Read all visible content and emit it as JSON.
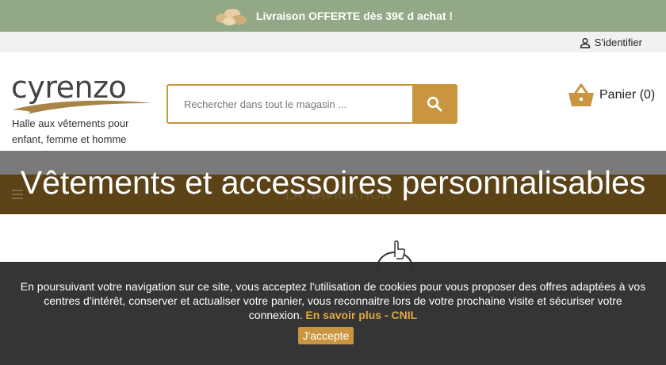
{
  "promo": {
    "text": "Livraison OFFERTE dès 39€ d achat !"
  },
  "account": {
    "signin_label": "S'identifier"
  },
  "brand": {
    "logo": "cyrenzo",
    "tagline": "Halle aux vêtements pour enfant, femme et homme"
  },
  "search": {
    "placeholder": "Rechercher dans tout le magasin ..."
  },
  "cart": {
    "label": "Panier (0)"
  },
  "nav": {
    "label": "LA NAVIGATION",
    "banner_title": "Vêtements et accessoires personnalisables"
  },
  "cookie": {
    "text": "En poursuivant votre navigation sur ce site, vous acceptez l'utilisation de cookies pour vous proposer des offres adaptées à vos centres d'intérêt, conserver et actualiser votre panier, vous reconnaitre lors de votre prochaine visite et sécuriser votre connexion.",
    "link_more": "En savoir plus",
    "separator": "-",
    "link_cnil": "CNIL",
    "accept_button": "J'accepte"
  },
  "colors": {
    "accent": "#c9953f",
    "promo_bg": "#93a886",
    "nav_bg": "#5b4217",
    "cookie_bg": "#2d2d2d"
  },
  "icons": [
    "shipping-chips-icon",
    "user-icon",
    "search-icon",
    "basket-icon",
    "menu-icon",
    "thumbs-up-badge-icon"
  ]
}
